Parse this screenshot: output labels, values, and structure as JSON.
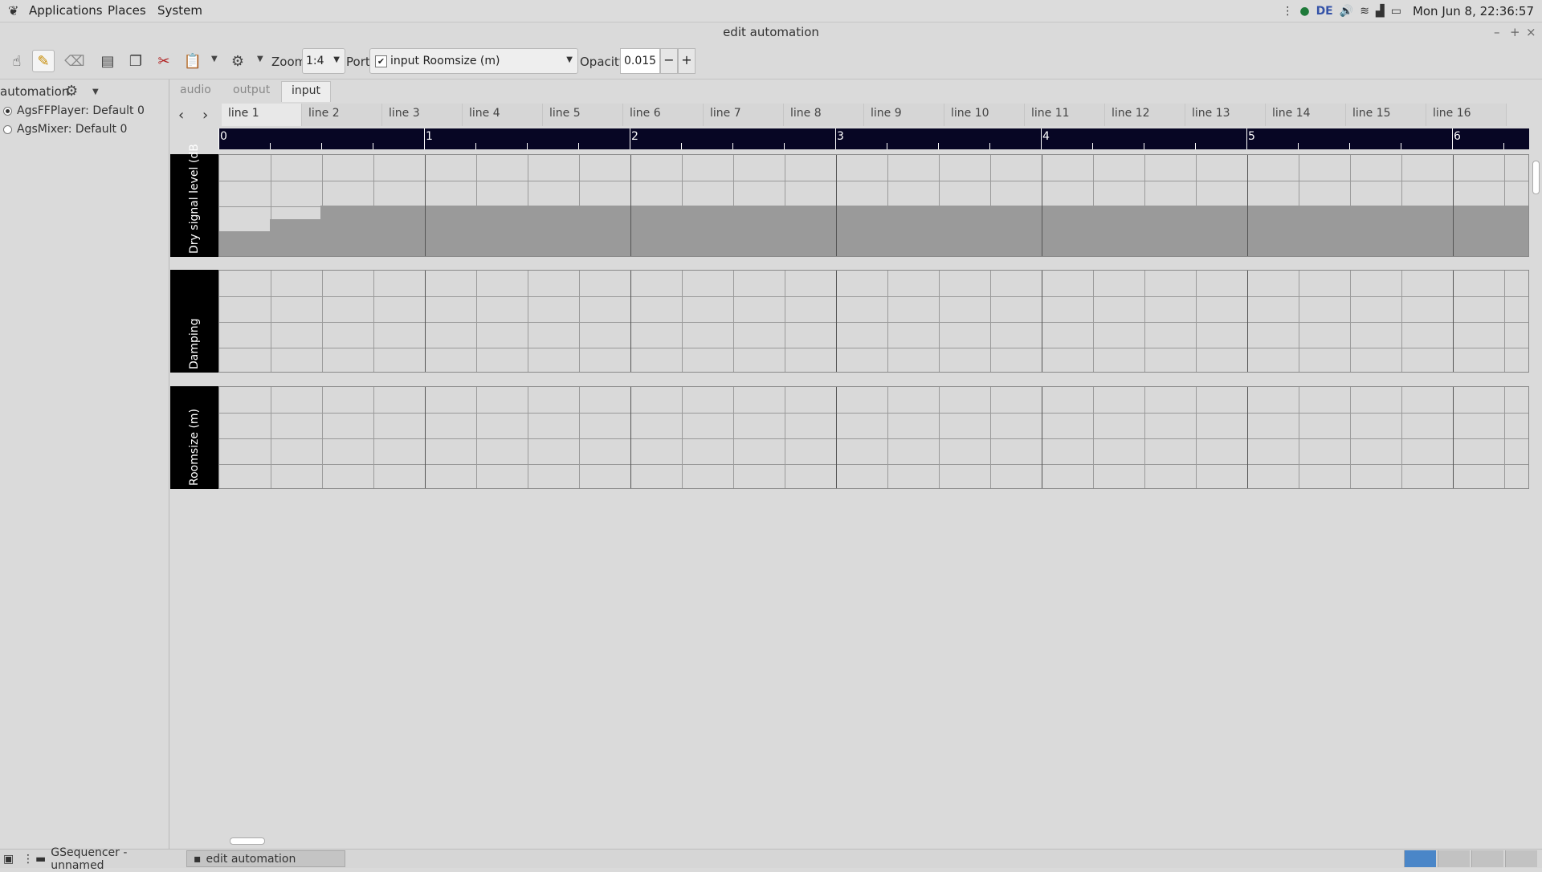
{
  "top_panel": {
    "menus": [
      "Applications",
      "Places",
      "System"
    ],
    "tray": {
      "keyboard_layout": "DE",
      "clock": "Mon Jun 8, 22:36:57"
    }
  },
  "window": {
    "title": "edit automation"
  },
  "toolbar": {
    "zoom_label": "Zoom",
    "zoom_value": "1:4",
    "port_label": "Port",
    "port_value": "input Roomsize (m)",
    "opacity_label": "Opacity",
    "opacity_value": "0.015",
    "minus": "−",
    "plus": "+"
  },
  "sidebar": {
    "title": "automation",
    "items": [
      {
        "label": "AgsFFPlayer: Default 0",
        "selected": true
      },
      {
        "label": "AgsMixer: Default 0",
        "selected": false
      }
    ]
  },
  "notebook_tabs": [
    {
      "label": "audio",
      "active": false
    },
    {
      "label": "output",
      "active": false
    },
    {
      "label": "input",
      "active": true
    }
  ],
  "line_tabs": [
    "line 1",
    "line 2",
    "line 3",
    "line 4",
    "line 5",
    "line 6",
    "line 7",
    "line 8",
    "line 9",
    "line 10",
    "line 11",
    "line 12",
    "line 13",
    "line 14",
    "line 15",
    "line 16"
  ],
  "ruler": {
    "labels": [
      "0",
      "1",
      "2",
      "3",
      "4",
      "5",
      "6"
    ]
  },
  "lanes": [
    {
      "label": "Dry signal level (dB"
    },
    {
      "label": "Damping"
    },
    {
      "label": "Roomsize (m)"
    }
  ],
  "taskbar": [
    {
      "label": "GSequencer - unnamed",
      "active": false
    },
    {
      "label": "edit automation",
      "active": true
    }
  ],
  "colors": {
    "ruler_bg": "#070624",
    "lane_label_bg": "#000000",
    "workspace_active": "#4a86c8"
  }
}
